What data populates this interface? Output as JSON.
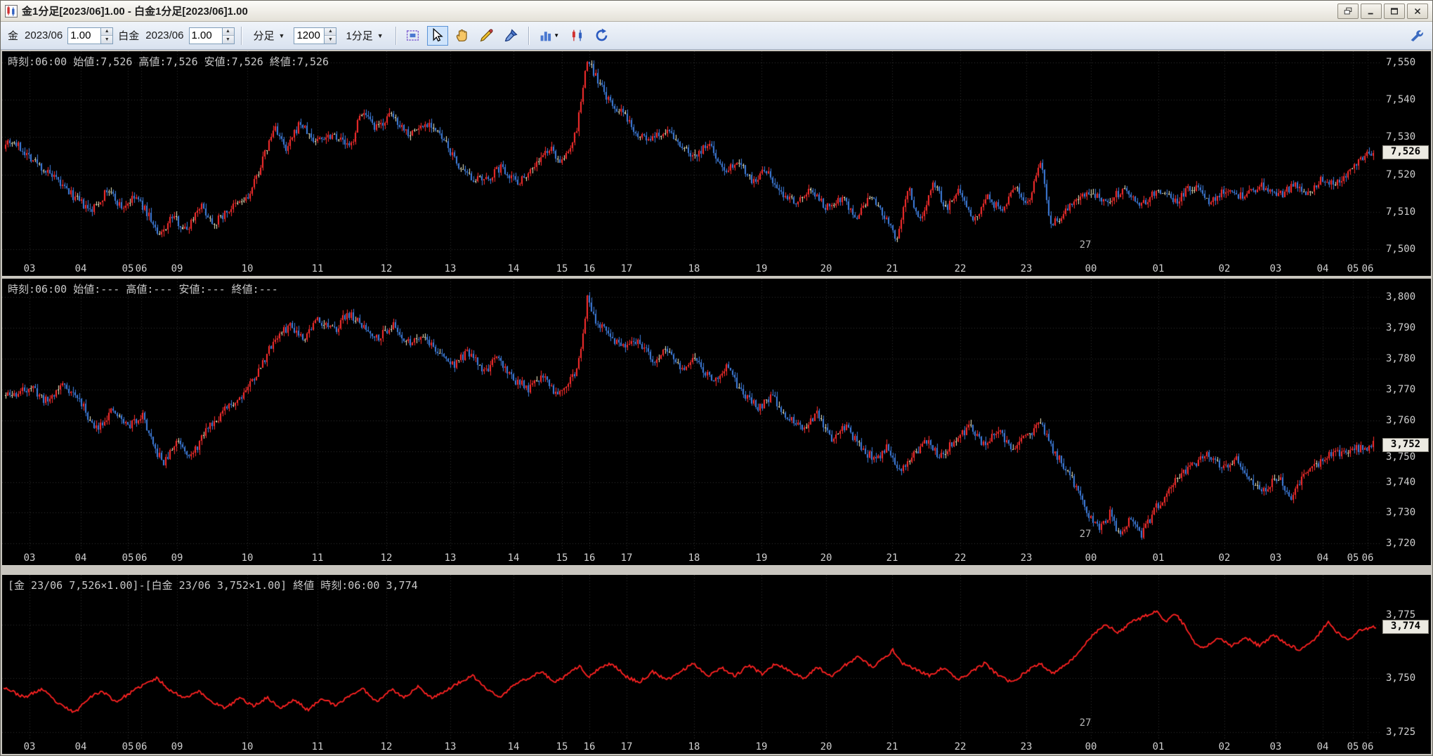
{
  "window": {
    "title": "金1分足[2023/06]1.00 - 白金1分足[2023/06]1.00"
  },
  "icons": {
    "spin_up": "▲",
    "spin_down": "▼",
    "dropdown_caret": "▼"
  },
  "toolbar": {
    "gold": {
      "symbol": "金",
      "contract": "2023/06",
      "multiplier": "1.00"
    },
    "platinum": {
      "symbol": "白金",
      "contract": "2023/06",
      "multiplier": "1.00"
    },
    "bar_type": "分足",
    "bar_count": "1200",
    "interval": "1分足"
  },
  "x_axis": {
    "labels": [
      "03",
      "04",
      "05",
      "06",
      "09",
      "10",
      "11",
      "12",
      "13",
      "14",
      "15",
      "16",
      "17",
      "18",
      "19",
      "20",
      "21",
      "22",
      "23",
      "00",
      "01",
      "02",
      "03",
      "04",
      "05",
      "06"
    ],
    "fracs": [
      0.02,
      0.057,
      0.091,
      0.101,
      0.127,
      0.178,
      0.229,
      0.279,
      0.325,
      0.371,
      0.406,
      0.426,
      0.453,
      0.502,
      0.551,
      0.598,
      0.646,
      0.695,
      0.743,
      0.79,
      0.839,
      0.887,
      0.924,
      0.958,
      0.98,
      0.991
    ],
    "date_label": "27",
    "date_frac": 0.786
  },
  "panels": [
    {
      "info": "時刻:06:00 始値:7,526 高値:7,526 安値:7,526 終値:7,526",
      "y_labels": [
        "7,550",
        "7,540",
        "7,530",
        "7,520",
        "7,510",
        "7,500"
      ],
      "y_values": [
        7550,
        7540,
        7530,
        7520,
        7510,
        7500
      ],
      "badge": "7,526",
      "badge_value": 7526
    },
    {
      "info": "時刻:06:00 始値:--- 高値:--- 安値:--- 終値:---",
      "y_labels": [
        "3,800",
        "3,790",
        "3,780",
        "3,770",
        "3,760",
        "3,750",
        "3,740",
        "3,730",
        "3,720"
      ],
      "y_values": [
        3800,
        3790,
        3780,
        3770,
        3760,
        3750,
        3740,
        3730,
        3720
      ],
      "badge": "3,752",
      "badge_value": 3752
    },
    {
      "info": "[金 23/06 7,526×1.00]-[白金 23/06 3,752×1.00] 終値 時刻:06:00 3,774",
      "y_labels": [
        "3,775",
        "3,750",
        "3,725"
      ],
      "y_values": [
        3775,
        3750,
        3725
      ],
      "badge": "3,774",
      "badge_value": 3774
    }
  ],
  "chart_data": [
    {
      "type": "candlestick",
      "ylim": [
        7497,
        7553
      ],
      "seed": 7,
      "noise": 2.2,
      "wick": 1.3,
      "up_color": "#ff2e2e",
      "down_color": "#3f7fe0",
      "flat_color": "#f2edc4",
      "anchors": [
        [
          0.005,
          7529
        ],
        [
          0.02,
          7524
        ],
        [
          0.035,
          7519
        ],
        [
          0.05,
          7514
        ],
        [
          0.062,
          7510
        ],
        [
          0.075,
          7516
        ],
        [
          0.085,
          7511
        ],
        [
          0.095,
          7514
        ],
        [
          0.105,
          7509
        ],
        [
          0.112,
          7503
        ],
        [
          0.122,
          7509
        ],
        [
          0.132,
          7505
        ],
        [
          0.142,
          7512
        ],
        [
          0.152,
          7507
        ],
        [
          0.165,
          7511
        ],
        [
          0.178,
          7514
        ],
        [
          0.19,
          7526
        ],
        [
          0.197,
          7533
        ],
        [
          0.205,
          7526
        ],
        [
          0.215,
          7534
        ],
        [
          0.225,
          7529
        ],
        [
          0.24,
          7531
        ],
        [
          0.252,
          7527
        ],
        [
          0.26,
          7537
        ],
        [
          0.27,
          7532
        ],
        [
          0.282,
          7536
        ],
        [
          0.295,
          7531
        ],
        [
          0.31,
          7534
        ],
        [
          0.322,
          7528
        ],
        [
          0.335,
          7520
        ],
        [
          0.35,
          7518
        ],
        [
          0.362,
          7522
        ],
        [
          0.375,
          7518
        ],
        [
          0.388,
          7523
        ],
        [
          0.398,
          7527
        ],
        [
          0.407,
          7523
        ],
        [
          0.417,
          7531
        ],
        [
          0.4255,
          7551
        ],
        [
          0.433,
          7545
        ],
        [
          0.442,
          7539
        ],
        [
          0.452,
          7536
        ],
        [
          0.462,
          7531
        ],
        [
          0.472,
          7529
        ],
        [
          0.483,
          7532
        ],
        [
          0.493,
          7528
        ],
        [
          0.503,
          7525
        ],
        [
          0.515,
          7528
        ],
        [
          0.525,
          7521
        ],
        [
          0.536,
          7524
        ],
        [
          0.546,
          7518
        ],
        [
          0.556,
          7521
        ],
        [
          0.566,
          7515
        ],
        [
          0.578,
          7513
        ],
        [
          0.59,
          7516
        ],
        [
          0.6,
          7511
        ],
        [
          0.612,
          7514
        ],
        [
          0.622,
          7508
        ],
        [
          0.632,
          7514
        ],
        [
          0.642,
          7509
        ],
        [
          0.652,
          7502
        ],
        [
          0.66,
          7517
        ],
        [
          0.668,
          7507
        ],
        [
          0.678,
          7518
        ],
        [
          0.688,
          7511
        ],
        [
          0.698,
          7516
        ],
        [
          0.708,
          7508
        ],
        [
          0.718,
          7514
        ],
        [
          0.728,
          7510
        ],
        [
          0.738,
          7517
        ],
        [
          0.748,
          7512
        ],
        [
          0.757,
          7524
        ],
        [
          0.764,
          7506
        ],
        [
          0.772,
          7509
        ],
        [
          0.782,
          7513
        ],
        [
          0.792,
          7515
        ],
        [
          0.805,
          7513
        ],
        [
          0.818,
          7516
        ],
        [
          0.83,
          7512
        ],
        [
          0.843,
          7516
        ],
        [
          0.856,
          7513
        ],
        [
          0.868,
          7517
        ],
        [
          0.88,
          7513
        ],
        [
          0.893,
          7516
        ],
        [
          0.905,
          7514
        ],
        [
          0.917,
          7517
        ],
        [
          0.93,
          7514
        ],
        [
          0.942,
          7517
        ],
        [
          0.953,
          7515
        ],
        [
          0.963,
          7519
        ],
        [
          0.972,
          7517
        ],
        [
          0.982,
          7521
        ],
        [
          0.99,
          7524
        ],
        [
          1.0,
          7526
        ]
      ]
    },
    {
      "type": "candlestick",
      "ylim": [
        3718,
        3806
      ],
      "seed": 11,
      "noise": 2.8,
      "wick": 1.6,
      "up_color": "#ff2e2e",
      "down_color": "#3f7fe0",
      "flat_color": "#f2edc4",
      "anchors": [
        [
          0.005,
          3768
        ],
        [
          0.018,
          3771
        ],
        [
          0.03,
          3766
        ],
        [
          0.042,
          3772
        ],
        [
          0.055,
          3766
        ],
        [
          0.065,
          3757
        ],
        [
          0.078,
          3763
        ],
        [
          0.09,
          3758
        ],
        [
          0.1,
          3762
        ],
        [
          0.108,
          3751
        ],
        [
          0.116,
          3746
        ],
        [
          0.126,
          3754
        ],
        [
          0.136,
          3748
        ],
        [
          0.148,
          3758
        ],
        [
          0.16,
          3763
        ],
        [
          0.172,
          3768
        ],
        [
          0.185,
          3776
        ],
        [
          0.196,
          3786
        ],
        [
          0.208,
          3791
        ],
        [
          0.218,
          3787
        ],
        [
          0.228,
          3793
        ],
        [
          0.24,
          3789
        ],
        [
          0.25,
          3795
        ],
        [
          0.262,
          3790
        ],
        [
          0.272,
          3787
        ],
        [
          0.283,
          3791
        ],
        [
          0.294,
          3785
        ],
        [
          0.305,
          3788
        ],
        [
          0.316,
          3782
        ],
        [
          0.327,
          3778
        ],
        [
          0.338,
          3782
        ],
        [
          0.35,
          3776
        ],
        [
          0.36,
          3780
        ],
        [
          0.372,
          3773
        ],
        [
          0.383,
          3770
        ],
        [
          0.393,
          3775
        ],
        [
          0.402,
          3769
        ],
        [
          0.41,
          3772
        ],
        [
          0.418,
          3776
        ],
        [
          0.4255,
          3800
        ],
        [
          0.433,
          3791
        ],
        [
          0.443,
          3787
        ],
        [
          0.453,
          3783
        ],
        [
          0.463,
          3786
        ],
        [
          0.473,
          3779
        ],
        [
          0.484,
          3783
        ],
        [
          0.494,
          3776
        ],
        [
          0.505,
          3780
        ],
        [
          0.516,
          3773
        ],
        [
          0.527,
          3777
        ],
        [
          0.538,
          3769
        ],
        [
          0.55,
          3764
        ],
        [
          0.56,
          3768
        ],
        [
          0.571,
          3761
        ],
        [
          0.582,
          3757
        ],
        [
          0.593,
          3762
        ],
        [
          0.603,
          3754
        ],
        [
          0.614,
          3758
        ],
        [
          0.625,
          3751
        ],
        [
          0.636,
          3747
        ],
        [
          0.645,
          3752
        ],
        [
          0.653,
          3743
        ],
        [
          0.662,
          3748
        ],
        [
          0.673,
          3753
        ],
        [
          0.684,
          3748
        ],
        [
          0.695,
          3754
        ],
        [
          0.705,
          3758
        ],
        [
          0.715,
          3752
        ],
        [
          0.726,
          3756
        ],
        [
          0.737,
          3751
        ],
        [
          0.748,
          3755
        ],
        [
          0.757,
          3759
        ],
        [
          0.766,
          3750
        ],
        [
          0.776,
          3744
        ],
        [
          0.784,
          3737
        ],
        [
          0.792,
          3729
        ],
        [
          0.8,
          3725
        ],
        [
          0.808,
          3730
        ],
        [
          0.814,
          3723
        ],
        [
          0.822,
          3728
        ],
        [
          0.83,
          3722
        ],
        [
          0.84,
          3731
        ],
        [
          0.85,
          3737
        ],
        [
          0.86,
          3743
        ],
        [
          0.87,
          3746
        ],
        [
          0.88,
          3749
        ],
        [
          0.89,
          3744
        ],
        [
          0.9,
          3748
        ],
        [
          0.91,
          3741
        ],
        [
          0.92,
          3737
        ],
        [
          0.93,
          3742
        ],
        [
          0.94,
          3735
        ],
        [
          0.95,
          3743
        ],
        [
          0.96,
          3746
        ],
        [
          0.97,
          3749
        ],
        [
          0.98,
          3750
        ],
        [
          1.0,
          3752
        ]
      ]
    },
    {
      "type": "line",
      "ylim": [
        3722,
        3798
      ],
      "seed": 23,
      "noise": 1.4,
      "line_color": "#ff2222",
      "anchors": [
        [
          0.0,
          3746
        ],
        [
          0.015,
          3741
        ],
        [
          0.028,
          3745
        ],
        [
          0.04,
          3738
        ],
        [
          0.052,
          3734
        ],
        [
          0.062,
          3741
        ],
        [
          0.072,
          3744
        ],
        [
          0.082,
          3739
        ],
        [
          0.092,
          3743
        ],
        [
          0.102,
          3747
        ],
        [
          0.112,
          3750
        ],
        [
          0.122,
          3744
        ],
        [
          0.132,
          3741
        ],
        [
          0.142,
          3744
        ],
        [
          0.152,
          3739
        ],
        [
          0.162,
          3736
        ],
        [
          0.172,
          3741
        ],
        [
          0.182,
          3737
        ],
        [
          0.192,
          3741
        ],
        [
          0.202,
          3736
        ],
        [
          0.212,
          3740
        ],
        [
          0.222,
          3735
        ],
        [
          0.232,
          3741
        ],
        [
          0.242,
          3737
        ],
        [
          0.252,
          3742
        ],
        [
          0.262,
          3745
        ],
        [
          0.272,
          3739
        ],
        [
          0.282,
          3745
        ],
        [
          0.292,
          3741
        ],
        [
          0.302,
          3746
        ],
        [
          0.312,
          3741
        ],
        [
          0.322,
          3744
        ],
        [
          0.332,
          3748
        ],
        [
          0.342,
          3751
        ],
        [
          0.352,
          3745
        ],
        [
          0.362,
          3741
        ],
        [
          0.372,
          3747
        ],
        [
          0.382,
          3750
        ],
        [
          0.392,
          3753
        ],
        [
          0.402,
          3748
        ],
        [
          0.412,
          3752
        ],
        [
          0.42,
          3756
        ],
        [
          0.4255,
          3750
        ],
        [
          0.433,
          3754
        ],
        [
          0.443,
          3757
        ],
        [
          0.453,
          3751
        ],
        [
          0.463,
          3748
        ],
        [
          0.473,
          3753
        ],
        [
          0.483,
          3749
        ],
        [
          0.493,
          3753
        ],
        [
          0.503,
          3757
        ],
        [
          0.513,
          3751
        ],
        [
          0.523,
          3755
        ],
        [
          0.533,
          3751
        ],
        [
          0.543,
          3756
        ],
        [
          0.553,
          3752
        ],
        [
          0.563,
          3757
        ],
        [
          0.573,
          3753
        ],
        [
          0.583,
          3750
        ],
        [
          0.593,
          3755
        ],
        [
          0.603,
          3751
        ],
        [
          0.613,
          3756
        ],
        [
          0.623,
          3760
        ],
        [
          0.633,
          3755
        ],
        [
          0.641,
          3759
        ],
        [
          0.648,
          3763
        ],
        [
          0.655,
          3757
        ],
        [
          0.665,
          3754
        ],
        [
          0.675,
          3751
        ],
        [
          0.685,
          3755
        ],
        [
          0.695,
          3749
        ],
        [
          0.705,
          3753
        ],
        [
          0.715,
          3757
        ],
        [
          0.725,
          3751
        ],
        [
          0.735,
          3748
        ],
        [
          0.745,
          3753
        ],
        [
          0.755,
          3757
        ],
        [
          0.765,
          3752
        ],
        [
          0.775,
          3757
        ],
        [
          0.782,
          3761
        ],
        [
          0.788,
          3766
        ],
        [
          0.795,
          3771
        ],
        [
          0.803,
          3775
        ],
        [
          0.812,
          3771
        ],
        [
          0.822,
          3776
        ],
        [
          0.832,
          3779
        ],
        [
          0.84,
          3781
        ],
        [
          0.847,
          3776
        ],
        [
          0.854,
          3780
        ],
        [
          0.862,
          3773
        ],
        [
          0.868,
          3766
        ],
        [
          0.875,
          3764
        ],
        [
          0.885,
          3769
        ],
        [
          0.895,
          3765
        ],
        [
          0.905,
          3769
        ],
        [
          0.915,
          3765
        ],
        [
          0.925,
          3770
        ],
        [
          0.935,
          3766
        ],
        [
          0.945,
          3763
        ],
        [
          0.955,
          3768
        ],
        [
          0.965,
          3776
        ],
        [
          0.972,
          3771
        ],
        [
          0.98,
          3768
        ],
        [
          0.988,
          3772
        ],
        [
          1.0,
          3774
        ]
      ]
    }
  ],
  "colors": {
    "panel_bg": "#000000",
    "grid": "#313131",
    "axis_text": "#cfcfcf",
    "badge_bg": "#eceae2",
    "badge_text": "#000000"
  }
}
